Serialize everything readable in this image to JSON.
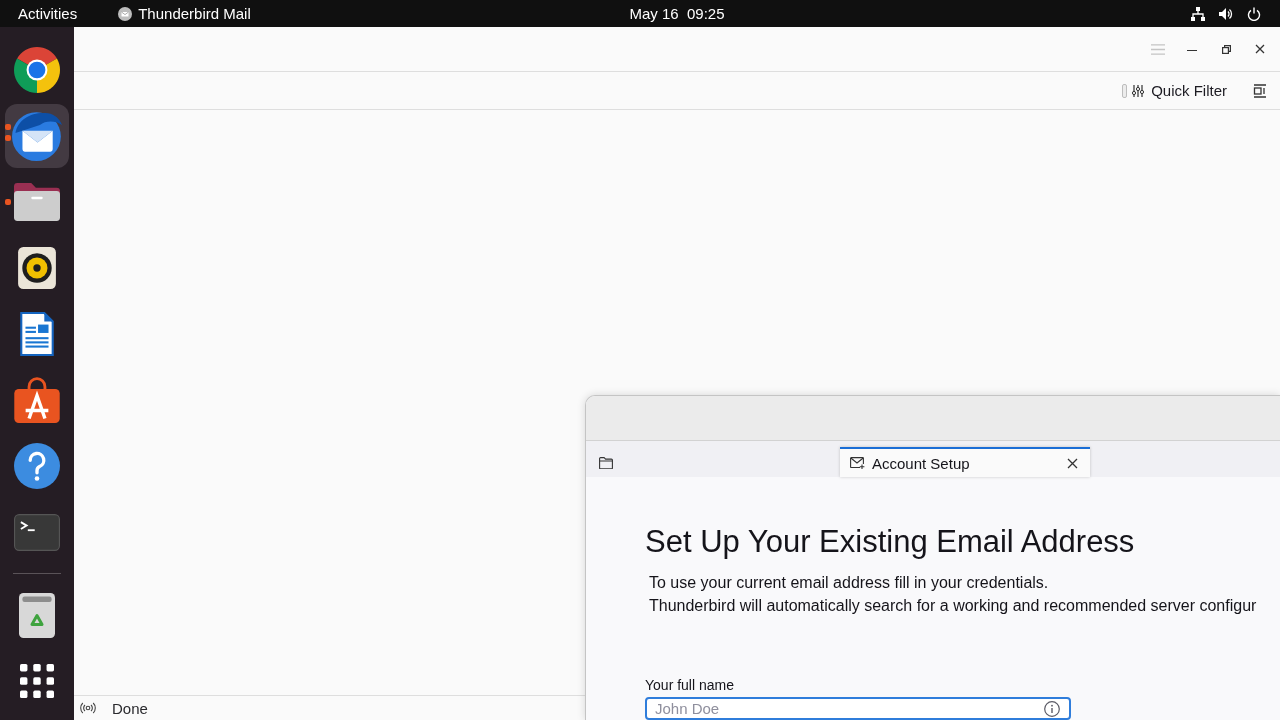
{
  "top_bar": {
    "activities": "Activities",
    "app_menu": "Thunderbird Mail",
    "clock": "May 16  09:25"
  },
  "dock": {
    "apps": [
      {
        "kind": "browser",
        "focused": false,
        "running": false
      },
      {
        "kind": "mail",
        "focused": true,
        "running": true,
        "several_windows": true
      },
      {
        "kind": "files",
        "focused": false,
        "running": true,
        "several_windows": false
      },
      {
        "kind": "music",
        "focused": false,
        "running": false
      },
      {
        "kind": "writer",
        "focused": false,
        "running": false
      },
      {
        "kind": "software",
        "focused": false,
        "running": false
      },
      {
        "kind": "help",
        "focused": false,
        "running": false
      },
      {
        "kind": "terminal",
        "focused": false,
        "running": false
      }
    ],
    "extras": [
      {
        "kind": "trash"
      },
      {
        "kind": "app-grid"
      }
    ]
  },
  "window": {
    "menu_button": {
      "disabled": true
    }
  },
  "toolbar": {
    "quick_filter": "Quick Filter"
  },
  "status_bar": {
    "text": "Done"
  },
  "dialog": {
    "tabs": [
      {
        "kind": "mail",
        "selected": false
      },
      {
        "kind": "setup",
        "label": "Account Setup",
        "selected": true
      }
    ],
    "heading": "Set Up Your Existing Email Address",
    "intro_lines": [
      "To use your current email address fill in your credentials.",
      "Thunderbird will automatically search for a working and recommended server configur"
    ],
    "fields": [
      {
        "label": "Your full name",
        "placeholder": "John Doe",
        "focused": true
      }
    ]
  }
}
